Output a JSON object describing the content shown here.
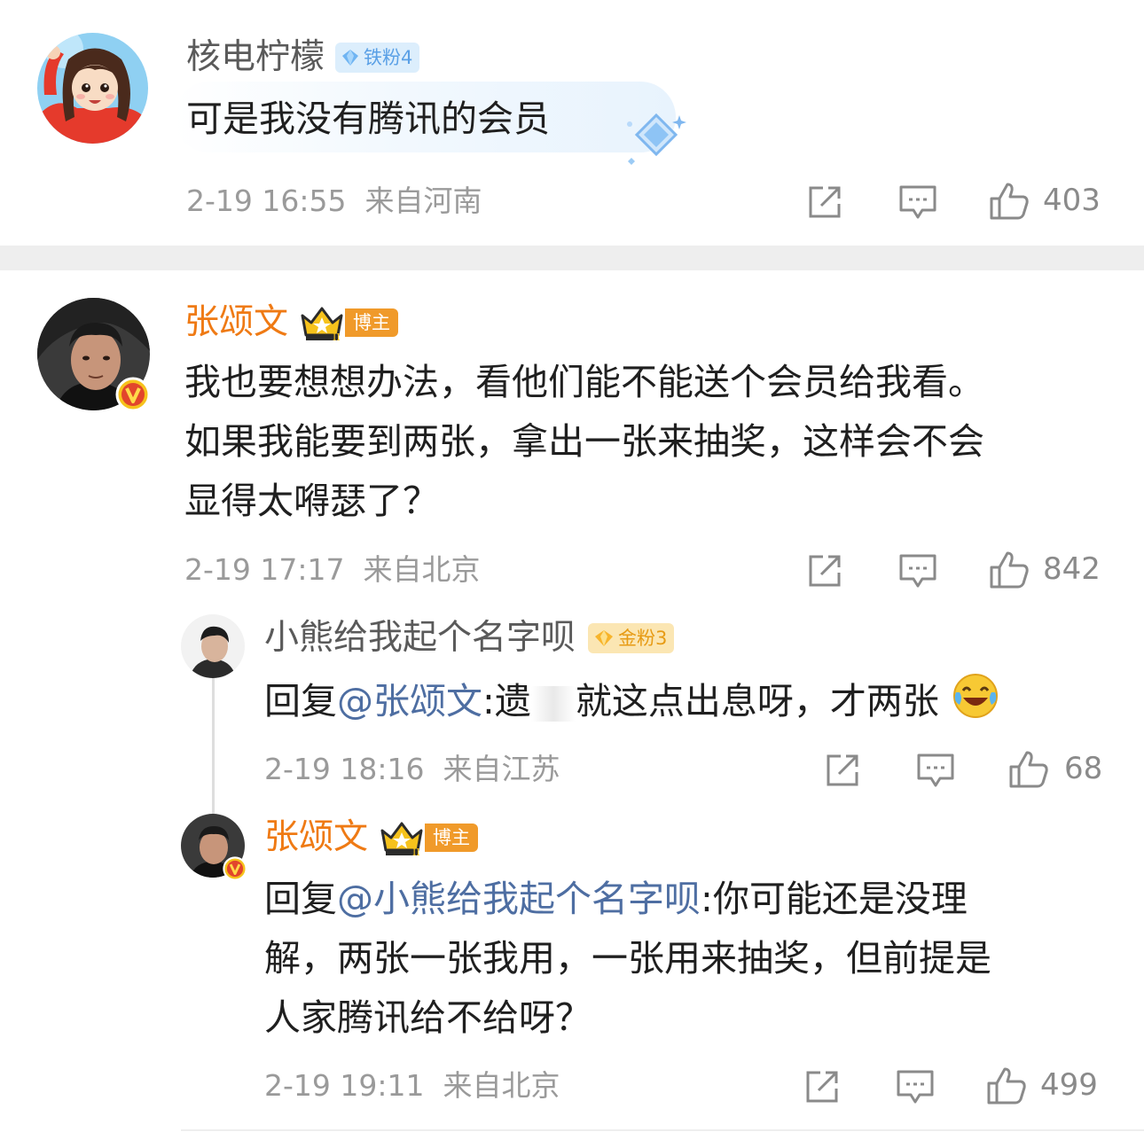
{
  "comments": [
    {
      "username": "核电柠檬",
      "badge": "铁粉4",
      "text": "可是我没有腾讯的会员",
      "time": "2-19 16:55",
      "location": "来自河南",
      "likes": "403"
    },
    {
      "username": "张颂文",
      "badge": "博主",
      "text_lines": [
        "我也要想想办法，看他们能不能送个会员给我看。",
        "如果我能要到两张，拿出一张来抽奖，这样会不会",
        "显得太嘚瑟了？"
      ],
      "time": "2-19 17:17",
      "location": "来自北京",
      "likes": "842"
    }
  ],
  "replies": [
    {
      "username": "小熊给我起个名字呗",
      "badge": "金粉3",
      "reply_prefix": "回复",
      "mention": "@张颂文",
      "colon": ":",
      "text": "遗",
      "text2": "就这点出息呀，才两张",
      "emoji": "laugh-cry-emoji",
      "time": "2-19 18:16",
      "location": "来自江苏",
      "likes": "68"
    },
    {
      "username": "张颂文",
      "badge": "博主",
      "reply_prefix": "回复",
      "mention": "@小熊给我起个名字呗",
      "colon": ":",
      "text_line1": "你可能还是没理",
      "text_line2": "解，两张一张我用，一张用来抽奖，但前提是",
      "text_line3": "人家腾讯给不给呀？",
      "time": "2-19 19:11",
      "location": "来自北京",
      "likes": "499"
    }
  ],
  "icons": {
    "share": "share-icon",
    "comment": "comment-icon",
    "like": "thumbs-up-icon",
    "verified": "verified-v-icon",
    "crown": "crown-icon",
    "diamond": "diamond-icon"
  },
  "colors": {
    "accent_orange": "#ef7a14",
    "mention_blue": "#4e6ea2",
    "meta_gray": "#9a9a9a"
  }
}
